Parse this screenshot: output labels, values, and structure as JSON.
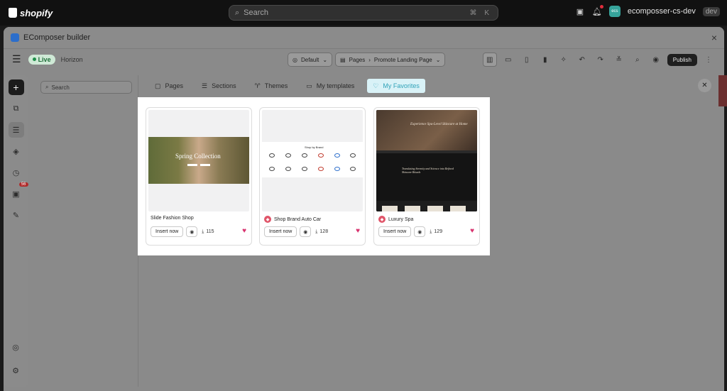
{
  "shopify": {
    "logo_text": "shopify",
    "search_placeholder": "Search",
    "search_shortcut": "⌘ K",
    "store_initials": "ecs",
    "store_name": "ecomposser-cs-dev",
    "store_badge": "dev"
  },
  "window": {
    "title": "EComposer builder",
    "close": "×"
  },
  "toolbar": {
    "live_label": "Live",
    "theme_name": "Horizon",
    "view_select": "Default",
    "page_type": "Pages",
    "page_name": "Promote Landing Page",
    "publish_label": "Publish"
  },
  "rail": {
    "badge_count": "56"
  },
  "panel": {
    "search_placeholder": "Search"
  },
  "tabs": [
    {
      "label": "Pages",
      "icon": "page-icon"
    },
    {
      "label": "Sections",
      "icon": "sections-icon"
    },
    {
      "label": "Themes",
      "icon": "shirt-icon"
    },
    {
      "label": "My templates",
      "icon": "folder-icon"
    },
    {
      "label": "My Favorites",
      "icon": "heart-icon",
      "active": true
    }
  ],
  "cards": [
    {
      "title": "Slide Fashion Shop",
      "insert_label": "Insert now",
      "downloads": "115",
      "has_brand": false,
      "thumb_text": "Spring Collection"
    },
    {
      "title": "Shop Brand Auto Car",
      "insert_label": "Insert now",
      "downloads": "128",
      "has_brand": true,
      "thumb_text": "Shop by Brand"
    },
    {
      "title": "Luxury Spa",
      "insert_label": "Insert now",
      "downloads": "129",
      "has_brand": true,
      "thumb_text": "Experience Spa-Level Skincare at Home",
      "thumb_text_2": "Translating Serenity and Science into Refined Skincare Rituals"
    }
  ],
  "colors": {
    "accent": "#31a3b9",
    "heart": "#d8336e",
    "live": "#1f8f4a"
  }
}
